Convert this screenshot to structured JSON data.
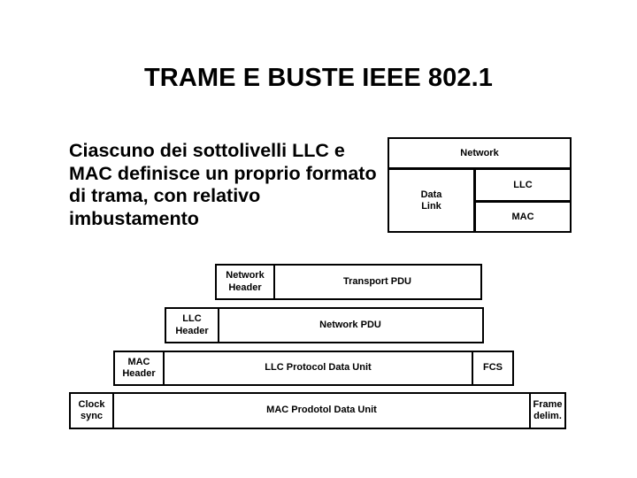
{
  "slide": {
    "title": "TRAME E BUSTE IEEE 802.1",
    "body_text": "Ciascuno dei sottolivelli LLC e MAC definisce un proprio formato di trama, con relativo imbustamento",
    "background_color": "#ffffff",
    "text_color": "#000000",
    "border_color": "#000000"
  },
  "layer_diagram": {
    "network": "Network",
    "data_link": "Data\nLink",
    "data_link_line1": "Data",
    "data_link_line2": "Link",
    "llc": "LLC",
    "mac": "MAC"
  },
  "encapsulation": {
    "rows": [
      {
        "name": "network-pdu-row",
        "header_line1": "Network",
        "header_line2": "Header",
        "payload": "Transport PDU",
        "trailer": null
      },
      {
        "name": "llc-pdu-row",
        "header_line1": "LLC",
        "header_line2": "Header",
        "payload": "Network PDU",
        "trailer": null
      },
      {
        "name": "mac-pdu-row",
        "header_line1": "MAC",
        "header_line2": "Header",
        "payload": "LLC Protocol Data Unit",
        "trailer": "FCS"
      },
      {
        "name": "frame-row",
        "header_line1": "Clock",
        "header_line2": "sync",
        "payload": "MAC Prodotol Data Unit",
        "trailer_line1": "Frame",
        "trailer_line2": "delim."
      }
    ]
  }
}
